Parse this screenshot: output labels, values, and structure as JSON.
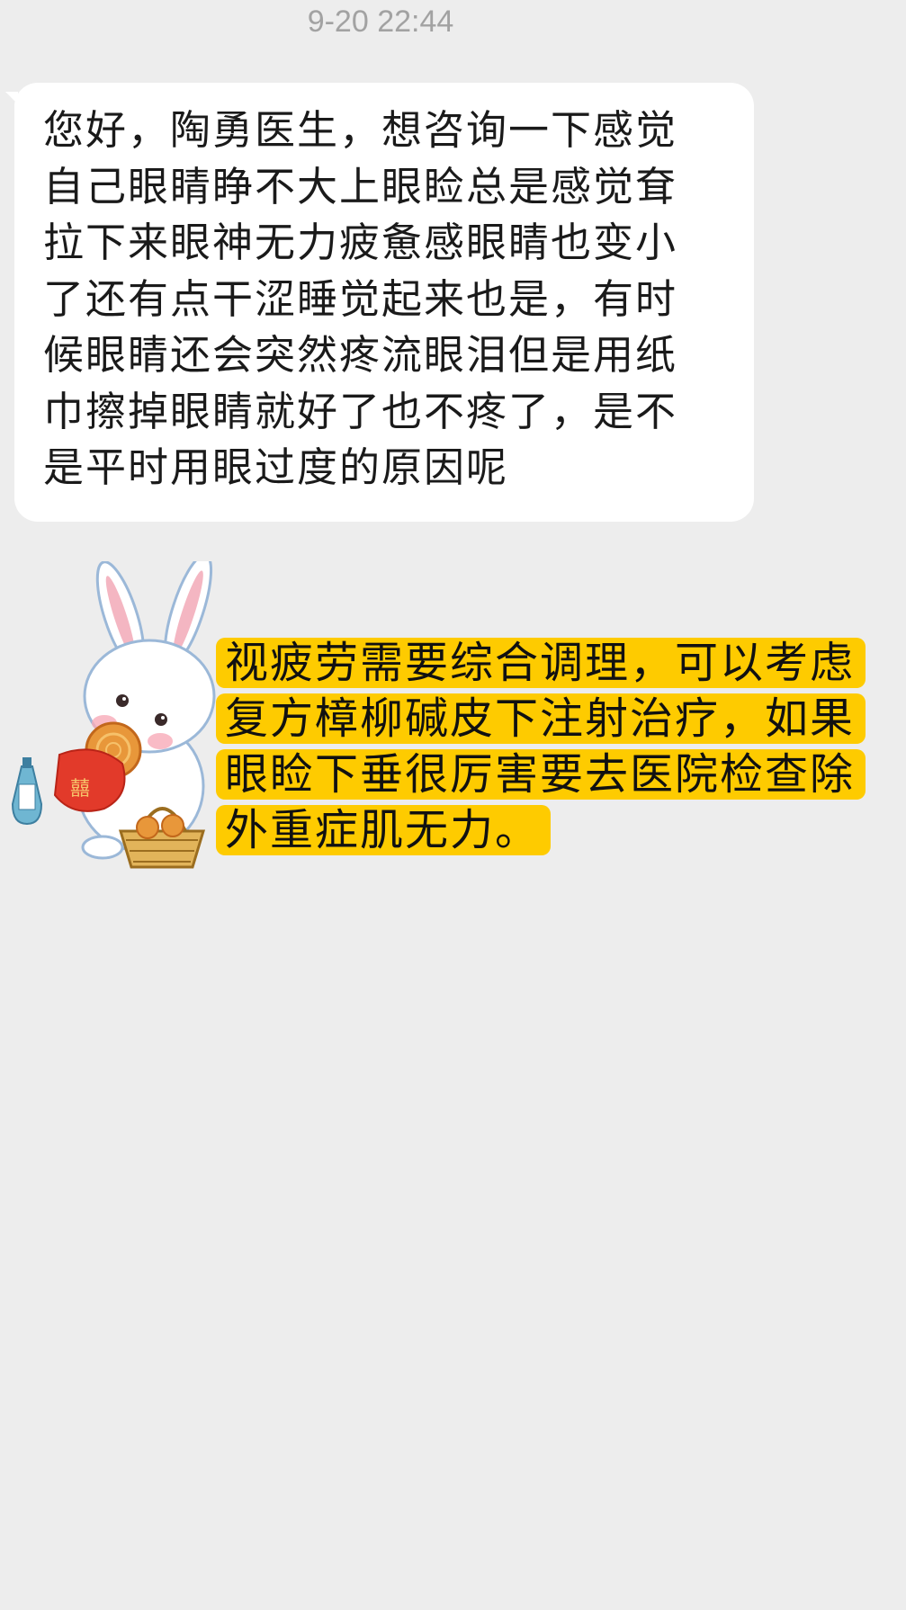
{
  "timestamp": "9-20 22:44",
  "incoming_message": {
    "lines": [
      "您好，陶勇医生，想咨询一下感觉",
      "自己眼睛睁不大上眼睑总是感觉耷",
      "拉下来眼神无力疲惫感眼睛也变小",
      "了还有点干涩睡觉起来也是，有时",
      "候眼睛还会突然疼流眼泪但是用纸",
      "巾擦掉眼睛就好了也不疼了，是不",
      "是平时用眼过度的原因呢"
    ],
    "bubble_color": "#ffffff"
  },
  "reply": {
    "lines": [
      "视疲劳需要综合调理，可以考虑",
      "复方樟柳碱皮下注射治疗，如果",
      "眼睑下垂很厉害要去医院检查除",
      "外重症肌无力。"
    ],
    "highlight_color": "#fecb00"
  },
  "avatar": {
    "icon": "rabbit-mooncake-icon"
  },
  "colors": {
    "background": "#ededed",
    "timestamp": "#a2a2a2"
  }
}
